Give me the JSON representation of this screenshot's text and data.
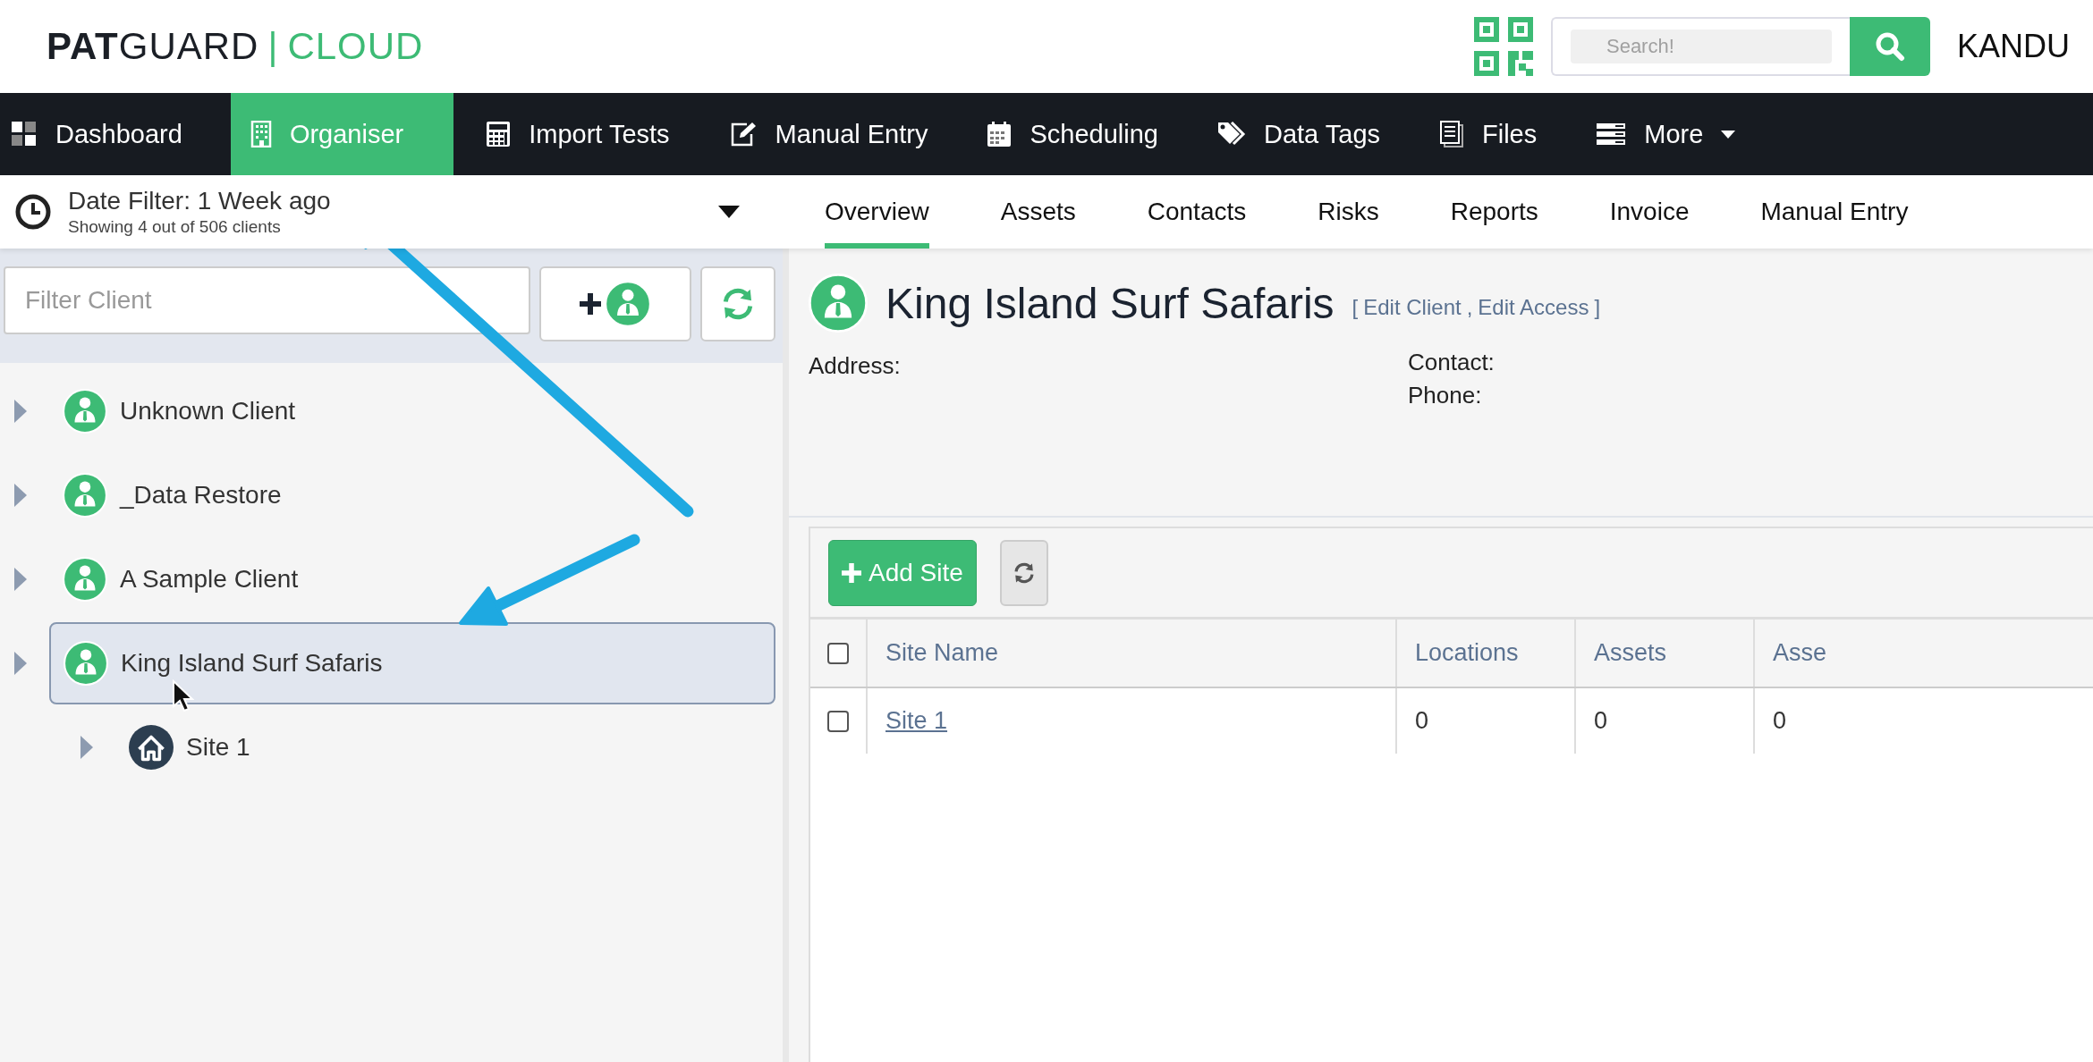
{
  "header": {
    "logo": {
      "bold": "PAT",
      "regular": "GUARD",
      "separator": "|",
      "accent": "CLOUD"
    },
    "search": {
      "placeholder": "Search!"
    },
    "user": "KANDU"
  },
  "nav": [
    {
      "kind": "dashboard",
      "label": "Dashboard",
      "selected": false
    },
    {
      "kind": "building",
      "label": "Organiser",
      "selected": true
    },
    {
      "kind": "calculator",
      "label": "Import Tests",
      "selected": false
    },
    {
      "kind": "pencil",
      "label": "Manual Entry",
      "selected": false
    },
    {
      "kind": "calendar",
      "label": "Scheduling",
      "selected": false
    },
    {
      "kind": "tags",
      "label": "Data Tags",
      "selected": false
    },
    {
      "kind": "files",
      "label": "Files",
      "selected": false
    },
    {
      "kind": "more",
      "label": "More",
      "selected": false
    }
  ],
  "date_filter": {
    "label": "Date Filter: 1 Week ago",
    "summary": "Showing 4 out of 506 clients"
  },
  "tabs": [
    {
      "label": "Overview",
      "selected": true
    },
    {
      "label": "Assets",
      "selected": false
    },
    {
      "label": "Contacts",
      "selected": false
    },
    {
      "label": "Risks",
      "selected": false
    },
    {
      "label": "Reports",
      "selected": false
    },
    {
      "label": "Invoice",
      "selected": false
    },
    {
      "label": "Manual Entry",
      "selected": false
    }
  ],
  "client_filter": {
    "placeholder": "Filter Client"
  },
  "tree": [
    {
      "kind": "client",
      "label": "Unknown Client",
      "selected": false
    },
    {
      "kind": "client",
      "label": "_Data Restore",
      "selected": false
    },
    {
      "kind": "client",
      "label": "A Sample Client",
      "selected": false
    },
    {
      "kind": "client",
      "label": "King Island Surf Safaris",
      "selected": true,
      "children": [
        {
          "kind": "site",
          "label": "Site 1",
          "selected": false
        }
      ]
    }
  ],
  "client": {
    "name": "King Island Surf Safaris",
    "open_bracket": "[",
    "links": [
      "Edit Client",
      "Edit Access"
    ],
    "link_separator": ",",
    "close_bracket": "]",
    "address_label": "Address:",
    "contact_label": "Contact:",
    "phone_label": "Phone:"
  },
  "sites": {
    "add_button": "Add Site",
    "select_all_checked": false,
    "columns": [
      "Site Name",
      "Locations",
      "Assets",
      "Asse"
    ],
    "rows": [
      {
        "checked": false,
        "cells": [
          "Site 1",
          "0",
          "0",
          "0"
        ]
      }
    ]
  }
}
